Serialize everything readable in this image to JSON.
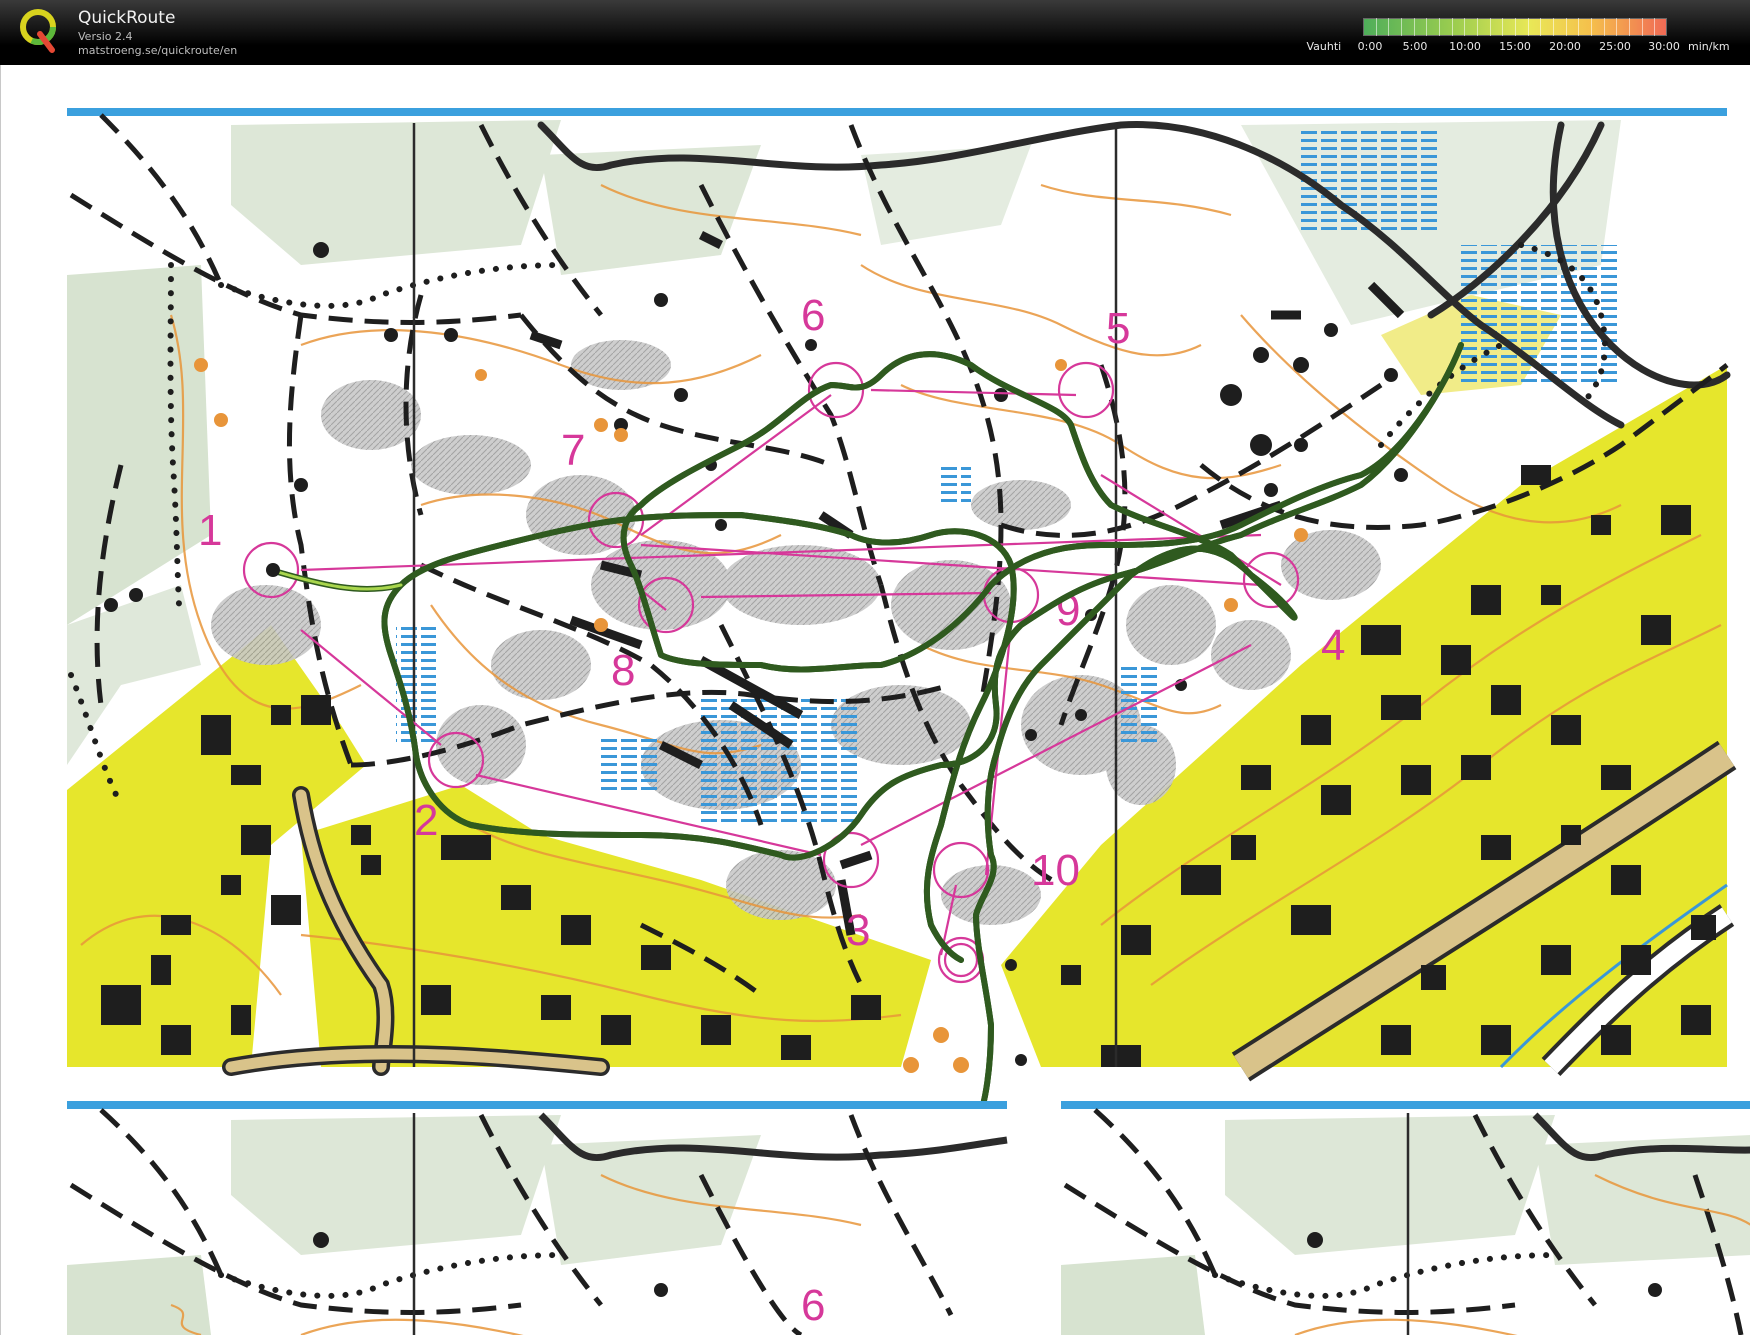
{
  "app": {
    "name": "QuickRoute",
    "version": "Versio 2.4",
    "url": "matstroeng.se/quickroute/en"
  },
  "pace_legend": {
    "label": "Vauhti",
    "ticks": [
      "0:00",
      "5:00",
      "10:00",
      "15:00",
      "20:00",
      "25:00",
      "30:00"
    ],
    "unit": "min/km",
    "colors": {
      "fast": "#4fae5a",
      "medium": "#e9e857",
      "slow": "#f06a55"
    }
  },
  "map": {
    "control_numbers": [
      "1",
      "2",
      "3",
      "4",
      "5",
      "6",
      "7",
      "8",
      "9",
      "10"
    ],
    "overprint_color": "#d6389a",
    "route_color": "#7db83a",
    "grid_line_color": "#3ba0de",
    "open_land_color": "#e6e62c"
  }
}
